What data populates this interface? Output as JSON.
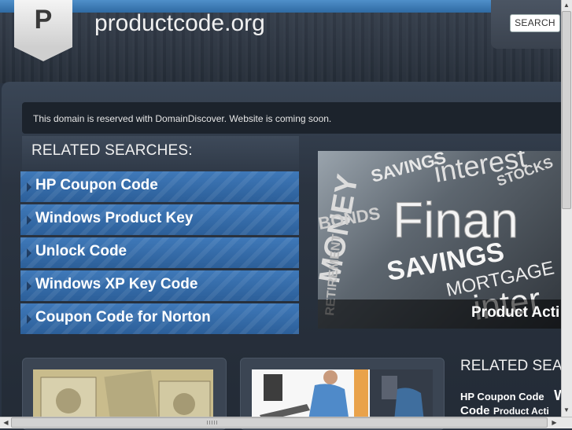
{
  "header": {
    "logo_letter": "P",
    "site_title": "productcode.org",
    "search_button": "SEARCH"
  },
  "notice": {
    "text": "This domain is reserved with DomainDiscover. Website is coming soon."
  },
  "related": {
    "title": "RELATED SEARCHES:",
    "items": [
      {
        "label": "HP Coupon Code"
      },
      {
        "label": "Windows Product Key"
      },
      {
        "label": "Unlock Code"
      },
      {
        "label": "Windows XP Key Code"
      },
      {
        "label": "Coupon Code for Norton"
      }
    ]
  },
  "hero": {
    "caption": "Product Acti",
    "words": [
      "SAVINGS",
      "Finan",
      "MONEY",
      "BONDS",
      "MORTGAGE",
      "interest",
      "STOCKS",
      "RETIREMENT",
      "SAVINGS",
      "inter"
    ]
  },
  "related_secondary": {
    "title": "RELATED SEAR",
    "links": [
      "HP Coupon Code",
      "Wi"
    ],
    "second_line": [
      "Code",
      "Product Acti"
    ]
  },
  "colors": {
    "link_blue": "#3a72b1",
    "header_dark": "#2e3642",
    "notice_bg": "#1c232c"
  }
}
